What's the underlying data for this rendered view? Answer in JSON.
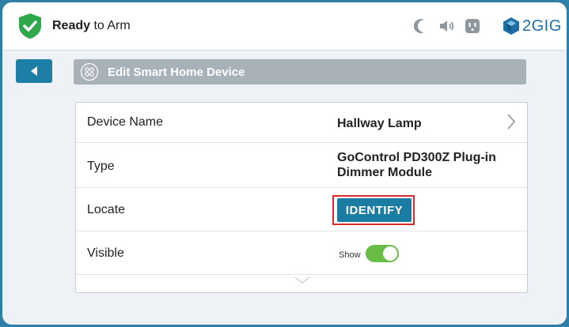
{
  "status": {
    "bold": "Ready",
    "rest": " to Arm"
  },
  "header_icons": [
    "moon-icon",
    "speaker-icon",
    "outlet-icon"
  ],
  "brand": {
    "name": "2GIG"
  },
  "titlebar": {
    "title": "Edit Smart Home Device"
  },
  "rows": [
    {
      "label": "Device Name",
      "value": "Hallway Lamp"
    },
    {
      "label": "Type",
      "value_line1": "GoControl PD300Z Plug-in",
      "value_line2": "Dimmer Module"
    },
    {
      "label": "Locate",
      "button": "IDENTIFY"
    },
    {
      "label": "Visible",
      "toggle_label": "Show",
      "toggle_on": true
    }
  ],
  "colors": {
    "accent": "#1a7ca0",
    "toggle_on": "#67bd45",
    "status_green": "#2ea84a",
    "highlight": "#d62b2b"
  }
}
